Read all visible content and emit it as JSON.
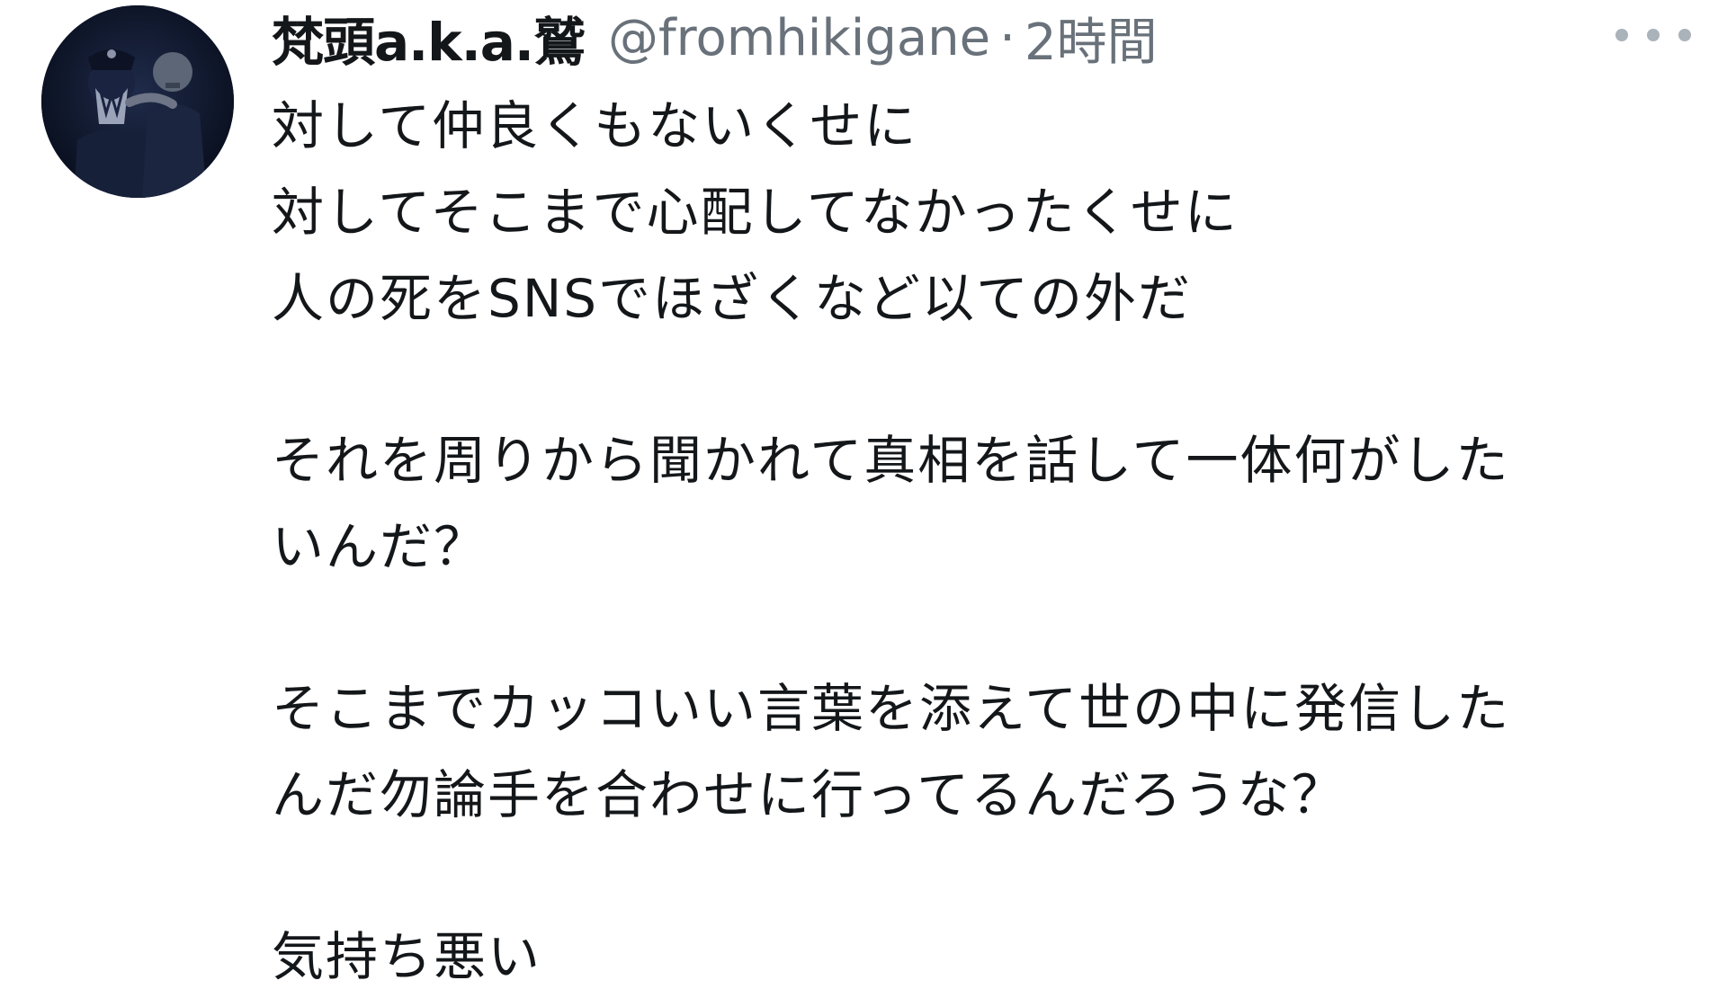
{
  "tweet": {
    "display_name": "梵頭a.k.a.鷲",
    "handle": "@fromhikigane",
    "separator": "·",
    "time": "2時間",
    "more_icon": "more-horizontal-icon",
    "lines": [
      "対して仲良くもないくせに",
      "対してそこまで心配してなかったくせに",
      "人の死をSNSでほざくなど以ての外だ",
      "それを周りから聞かれて真相を話して一体何がした",
      "いんだ？",
      "そこまでカッコいい言葉を添えて世の中に発信した",
      "んだ勿論手を合わせに行ってるんだろうな？",
      "気持ち悪い"
    ]
  }
}
